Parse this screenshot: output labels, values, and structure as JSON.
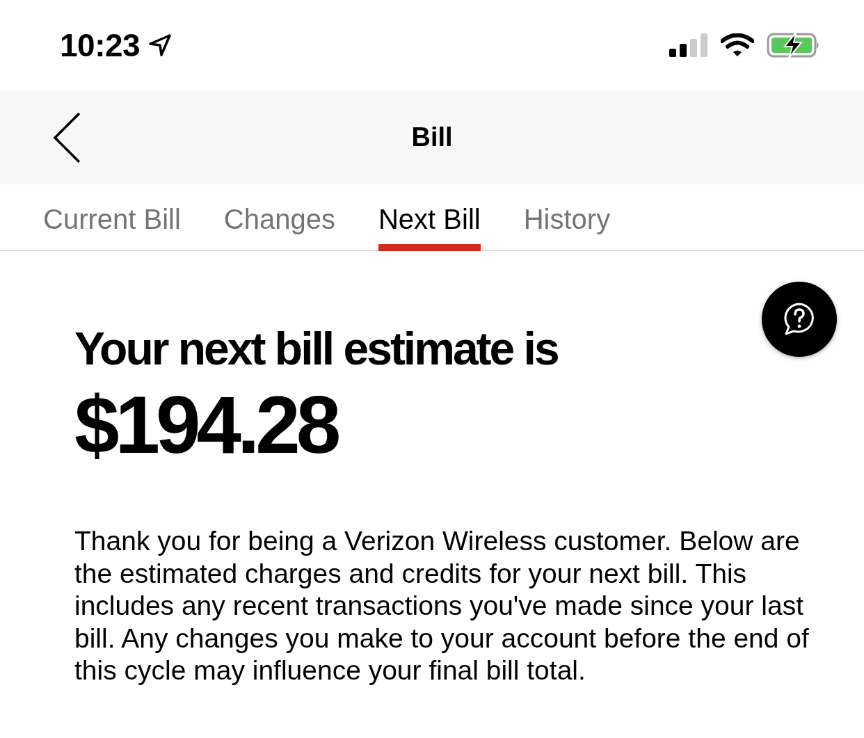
{
  "status_bar": {
    "time": "10:23"
  },
  "nav": {
    "title": "Bill"
  },
  "tabs": [
    {
      "label": "Current Bill",
      "selected": false
    },
    {
      "label": "Changes",
      "selected": false
    },
    {
      "label": "Next Bill",
      "selected": true
    },
    {
      "label": "History",
      "selected": false
    }
  ],
  "estimate": {
    "heading": "Your next bill estimate is",
    "amount": "$194.28"
  },
  "description": "Thank you for being a Verizon Wireless customer. Below are the estimated charges and credits for your next bill. This includes any recent transactions you've made since your last bill. Any changes you make to your account before the end of this cycle may influence your final bill total."
}
